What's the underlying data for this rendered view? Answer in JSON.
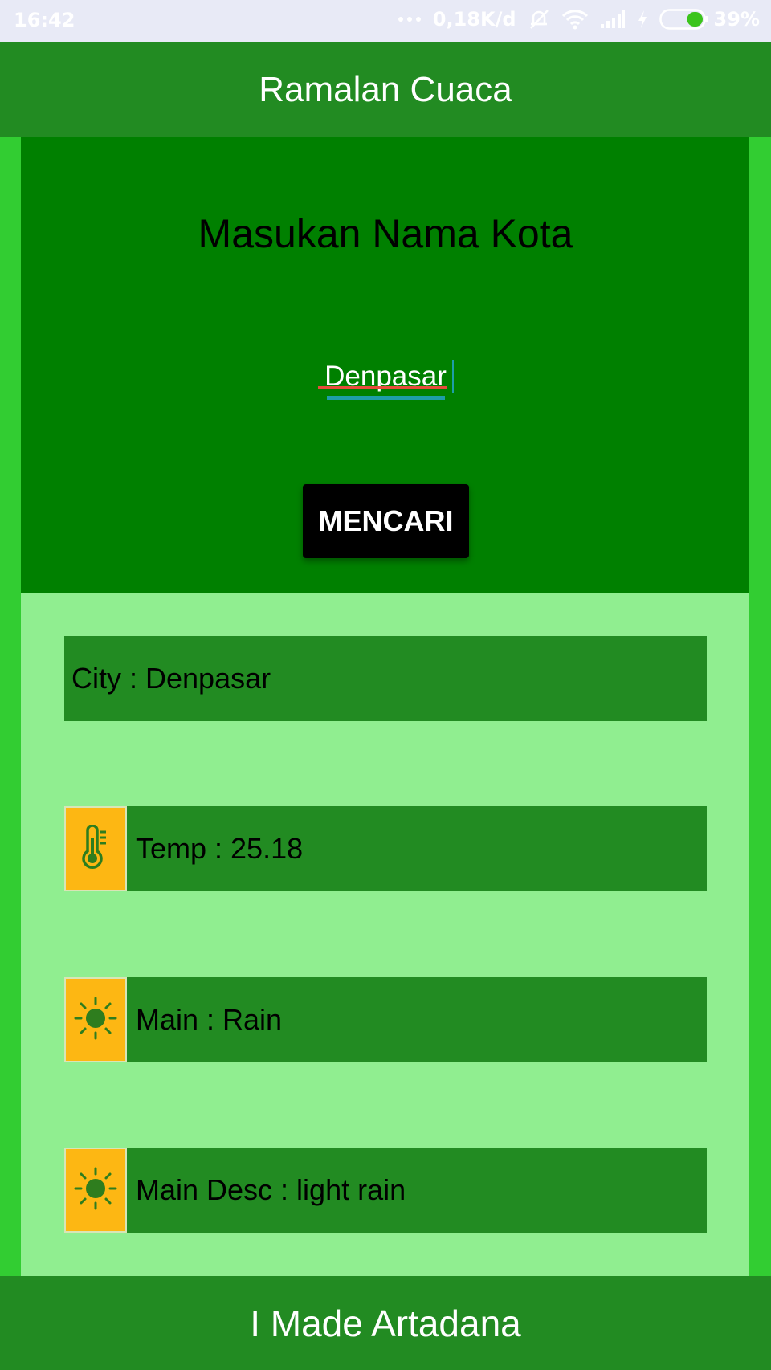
{
  "status_bar": {
    "time": "16:42",
    "network_speed": "0,18K/d",
    "battery_percent": "39%",
    "battery_level": 0.39
  },
  "app_bar": {
    "title": "Ramalan Cuaca"
  },
  "search": {
    "heading": "Masukan Nama Kota",
    "input_value": "Denpasar",
    "button_label": "MENCARI"
  },
  "results": {
    "city": "City : Denpasar",
    "temp": "Temp : 25.18",
    "main": "Main : Rain",
    "desc": "Main Desc : light rain"
  },
  "footer": {
    "text": "I Made Artadana"
  },
  "icons": {
    "temp": "thermometer-icon",
    "main": "sun-icon",
    "desc": "sun-icon"
  },
  "colors": {
    "app_bar": "#228b22",
    "search_panel": "#008000",
    "result_panel": "#90ee90",
    "side": "#32cd32",
    "icon_box": "#fdb713",
    "button": "#000000"
  }
}
